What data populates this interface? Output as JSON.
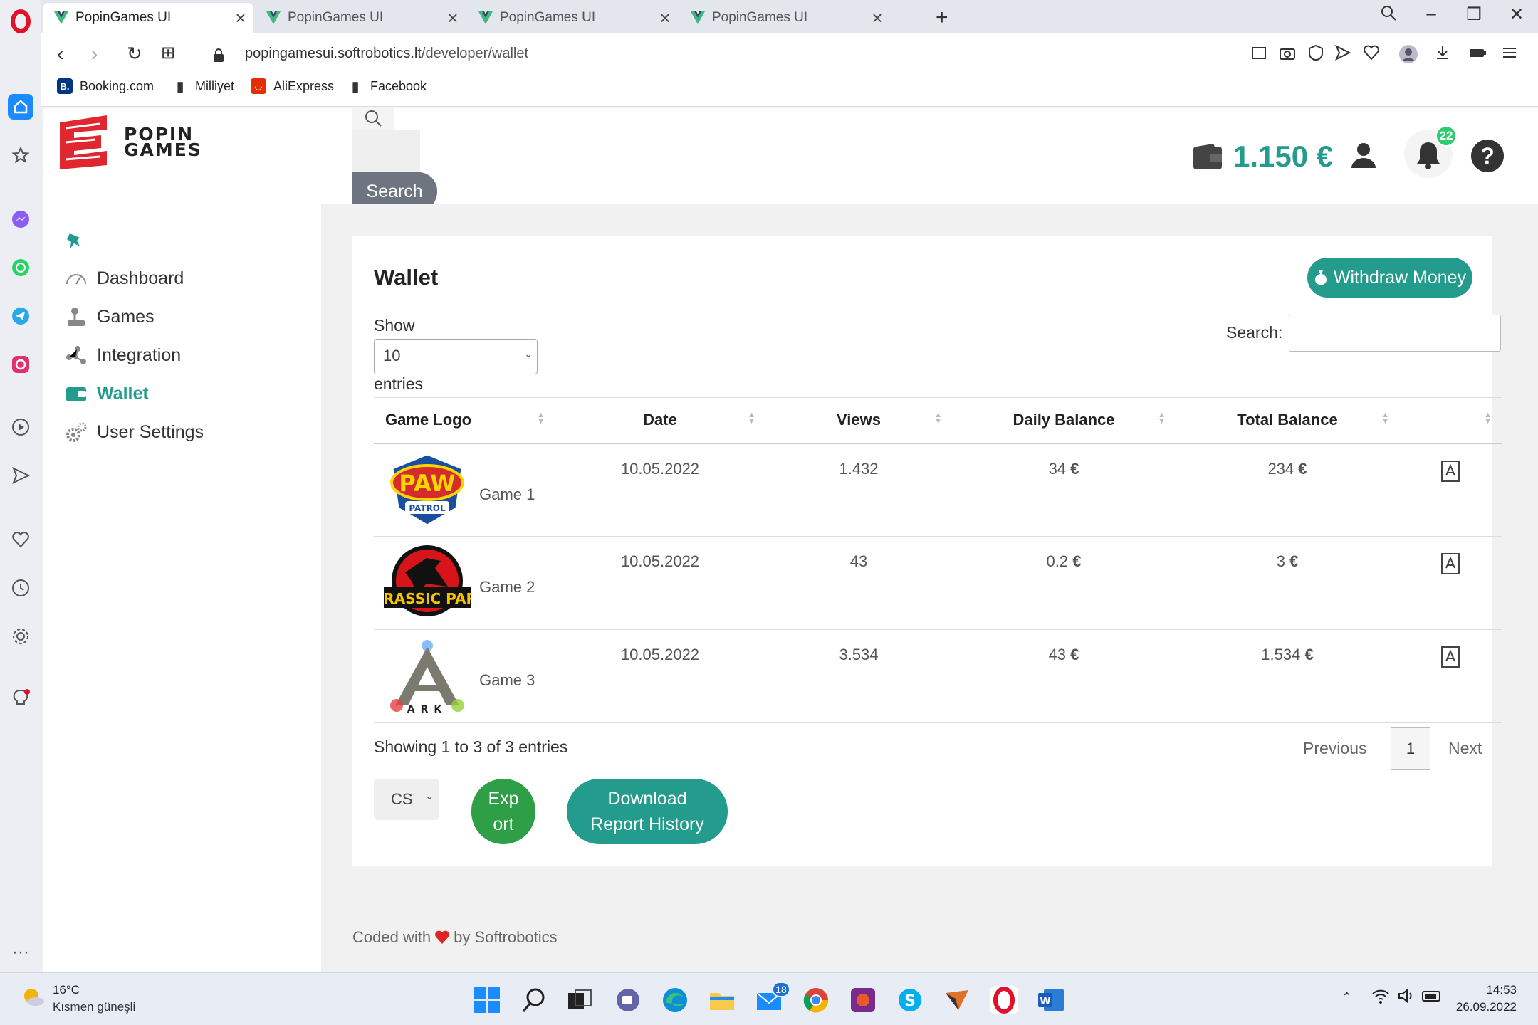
{
  "browser": {
    "tabs": [
      {
        "title": "PopinGames UI",
        "active": true
      },
      {
        "title": "PopinGames UI",
        "active": false
      },
      {
        "title": "PopinGames UI",
        "active": false
      },
      {
        "title": "PopinGames UI",
        "active": false
      }
    ],
    "url_host": "popingamesui.softrobotics.lt",
    "url_path": "/developer/wallet",
    "bookmarks": [
      "Booking.com",
      "Milliyet",
      "AliExpress",
      "Facebook"
    ]
  },
  "app": {
    "logo_text_line1": "POPIN",
    "logo_text_line2": "GAMES",
    "search_button": "Search",
    "balance": "1.150 €",
    "notification_count": "22",
    "accent_color": "#239c8d",
    "menu": [
      {
        "label": "Dashboard",
        "icon": "gauge-icon",
        "active": false
      },
      {
        "label": "Games",
        "icon": "joystick-icon",
        "active": false
      },
      {
        "label": "Integration",
        "icon": "network-icon",
        "active": false
      },
      {
        "label": "Wallet",
        "icon": "wallet-icon",
        "active": true
      },
      {
        "label": "User Settings",
        "icon": "gears-icon",
        "active": false
      }
    ]
  },
  "wallet": {
    "title": "Wallet",
    "withdraw_label": "Withdraw Money",
    "show_label": "Show",
    "entries_value": "10",
    "entries_label": "entries",
    "search_label": "Search:",
    "columns": [
      "Game Logo",
      "Date",
      "Views",
      "Daily Balance",
      "Total Balance"
    ],
    "rows": [
      {
        "game": "Game 1",
        "logo": "paw-patrol-logo",
        "date": "10.05.2022",
        "views": "1.432",
        "daily": "34",
        "total": "234"
      },
      {
        "game": "Game 2",
        "logo": "jurassic-park-logo",
        "date": "10.05.2022",
        "views": "43",
        "daily": "0.2",
        "total": "3"
      },
      {
        "game": "Game 3",
        "logo": "ark-logo",
        "date": "10.05.2022",
        "views": "3.534",
        "daily": "43",
        "total": "1.534"
      }
    ],
    "currency_symbol": "€",
    "showing_text": "Showing 1 to 3 of 3 entries",
    "prev_label": "Previous",
    "page": "1",
    "next_label": "Next",
    "format_value": "CS",
    "export_line1": "Exp",
    "export_line2": "ort",
    "download_line1": "Download",
    "download_line2": "Report History"
  },
  "footer": {
    "prefix": "Coded with",
    "suffix": "by Softrobotics"
  },
  "taskbar": {
    "temperature": "16°C",
    "weather": "Kısmen güneşli",
    "mail_badge": "18",
    "time": "14:53",
    "date": "26.09.2022"
  }
}
